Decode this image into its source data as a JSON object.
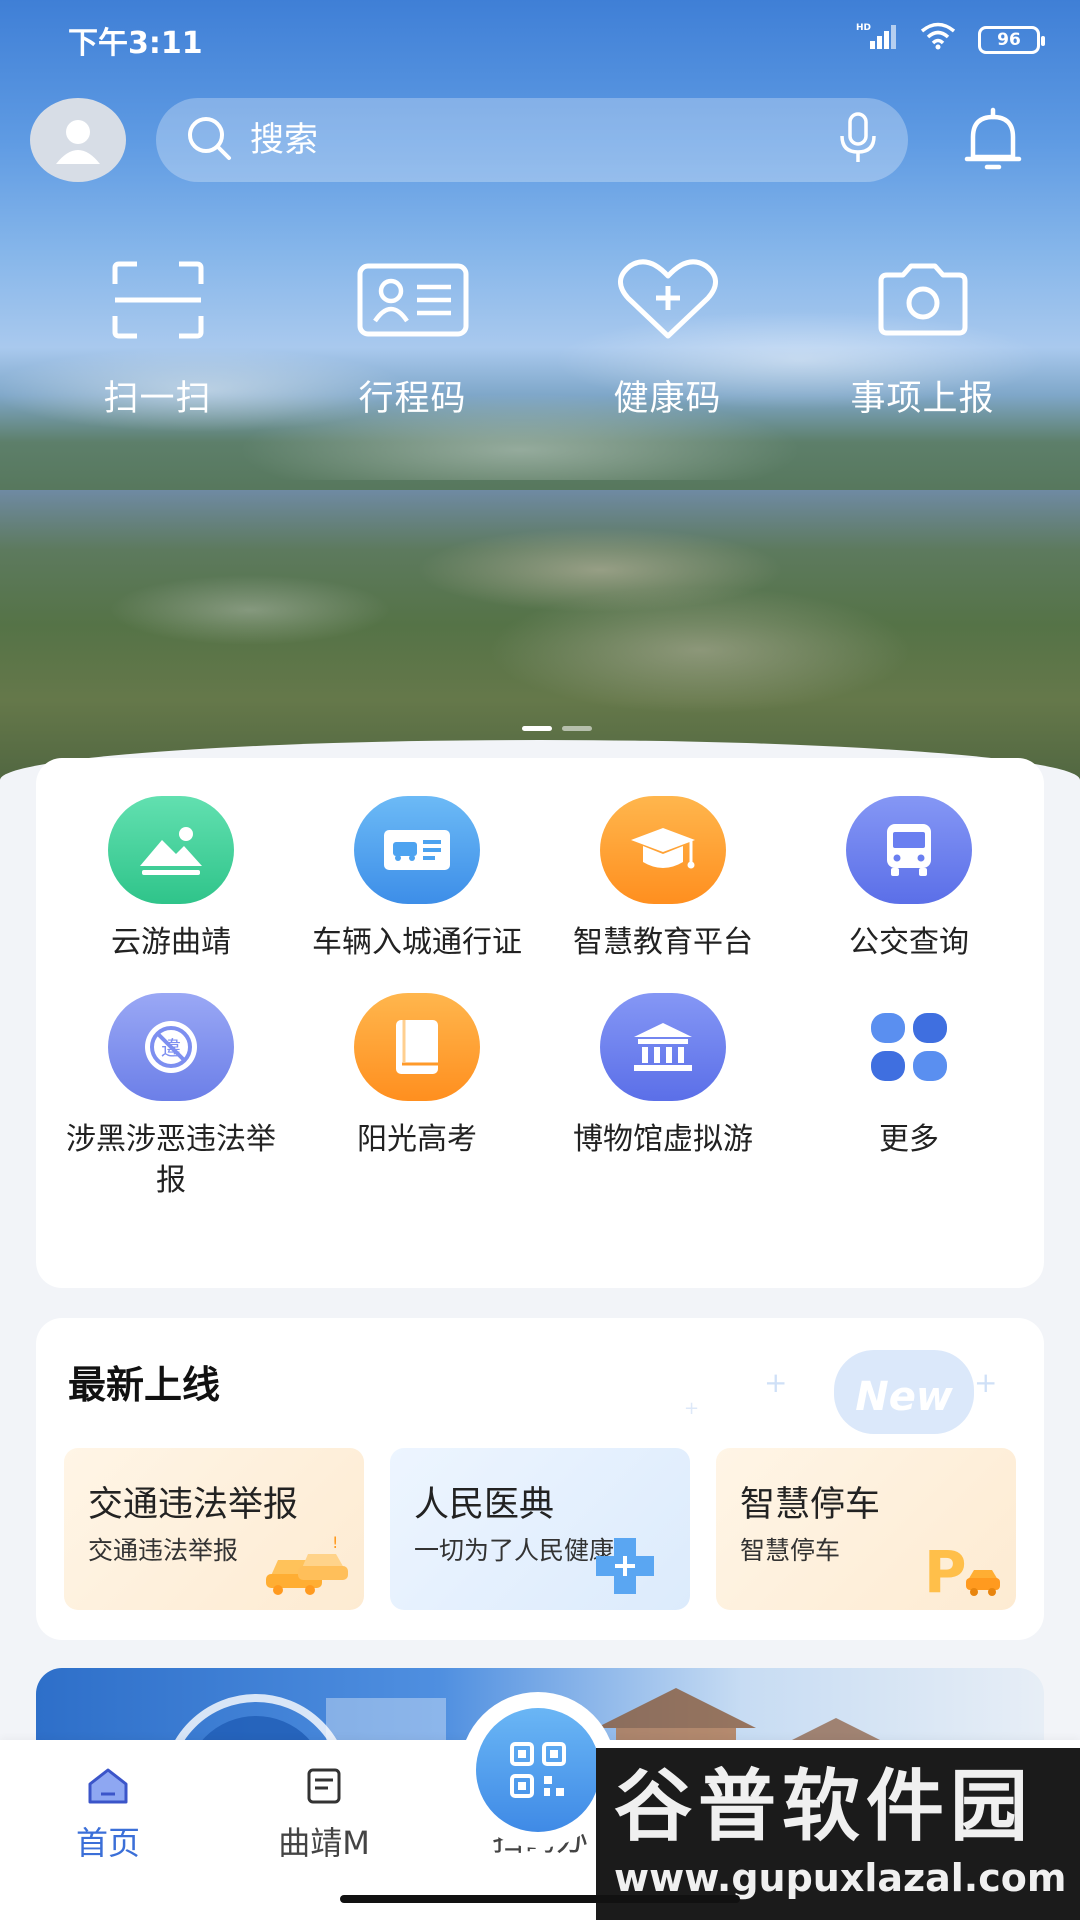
{
  "status_bar": {
    "time": "下午3:11",
    "network": "HD",
    "battery": "96"
  },
  "search": {
    "placeholder": "搜索"
  },
  "quick_actions": [
    {
      "label": "扫一扫",
      "icon": "scan-icon"
    },
    {
      "label": "行程码",
      "icon": "id-card-icon"
    },
    {
      "label": "健康码",
      "icon": "heart-plus-icon"
    },
    {
      "label": "事项上报",
      "icon": "camera-icon"
    }
  ],
  "services": [
    {
      "label": "云游曲靖",
      "icon": "landscape-icon",
      "color": "#3fcf9a"
    },
    {
      "label": "车辆入城通行证",
      "icon": "vehicle-pass-icon",
      "color": "#4da3f0"
    },
    {
      "label": "智慧教育平台",
      "icon": "graduation-cap-icon",
      "color": "#ffa033"
    },
    {
      "label": "公交查询",
      "icon": "bus-icon",
      "color": "#6a7ff0"
    },
    {
      "label": "涉黑涉恶违法举报",
      "icon": "prohibited-icon",
      "color": "#7d8ff0"
    },
    {
      "label": "阳光高考",
      "icon": "book-icon",
      "color": "#ffa033"
    },
    {
      "label": "博物馆虚拟游",
      "icon": "museum-icon",
      "color": "#6a7ff0"
    },
    {
      "label": "更多",
      "icon": "more-grid-icon",
      "color": "#4a7be8"
    }
  ],
  "newest": {
    "title": "最新上线",
    "badge": "New",
    "cards": [
      {
        "title": "交通违法举报",
        "subtitle": "交通违法举报",
        "icon": "cars-icon",
        "bg": "#fff3e3"
      },
      {
        "title": "人民医典",
        "subtitle": "一切为了人民健康",
        "icon": "medical-cross-icon",
        "bg": "#e8f2fe"
      },
      {
        "title": "智慧停车",
        "subtitle": "智慧停车",
        "icon": "parking-icon",
        "bg": "#fff3e3"
      }
    ]
  },
  "tabbar": [
    {
      "label": "首页",
      "icon": "home-icon",
      "active": true
    },
    {
      "label": "曲靖M",
      "icon": "document-icon",
      "active": false
    },
    {
      "label": "扫码办",
      "icon": "qr-code-icon",
      "active": false
    },
    {
      "label": "",
      "icon": "",
      "active": false
    },
    {
      "label": "",
      "icon": "",
      "active": false
    }
  ],
  "watermark": {
    "title": "谷普软件园",
    "url": "www.gupuxlazal.com"
  },
  "colors": {
    "accent": "#3b6fd8",
    "hero_top": "#3f7fd6"
  }
}
